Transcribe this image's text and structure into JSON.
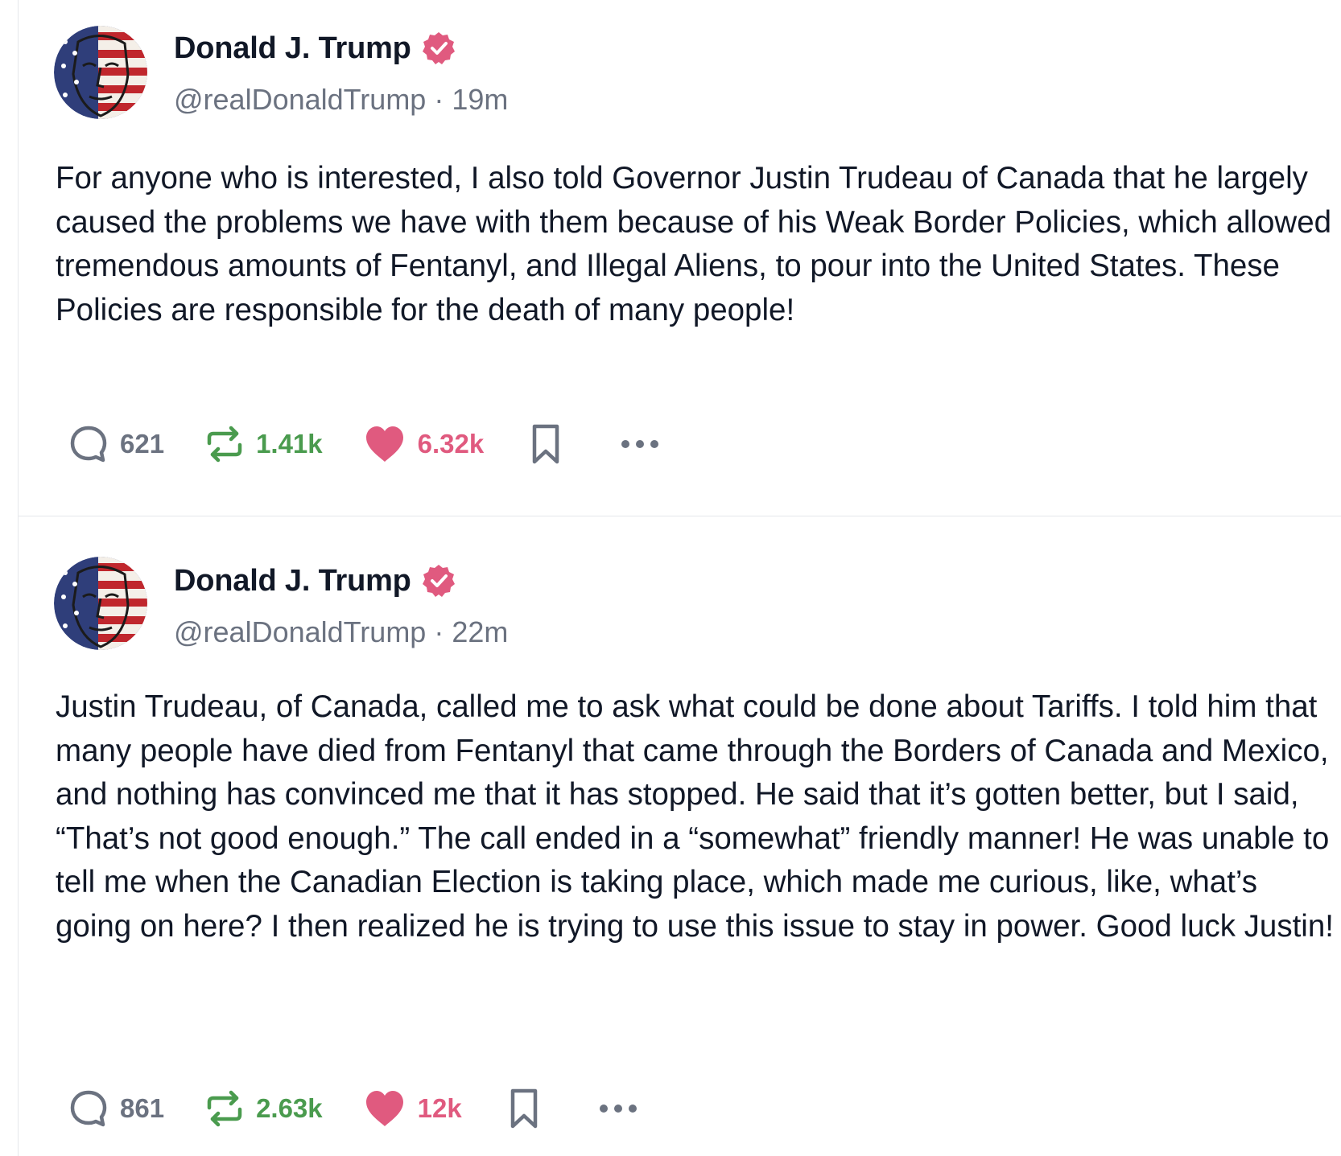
{
  "posts": [
    {
      "author": {
        "display_name": "Donald J. Trump",
        "handle": "@realDonaldTrump",
        "verified": true,
        "avatar_icon": "flag-face-avatar"
      },
      "time": "19m",
      "separator": "·",
      "text": "For anyone who is interested, I also told Governor Justin Trudeau of Canada that he largely caused the problems we have with them because of his Weak Border Policies, which allowed tremendous amounts of Fentanyl, and Illegal Aliens, to pour into the United States. These Policies are responsible for the death of many people!",
      "stats": {
        "replies": "621",
        "reposts": "1.41k",
        "likes": "6.32k"
      }
    },
    {
      "author": {
        "display_name": "Donald J. Trump",
        "handle": "@realDonaldTrump",
        "verified": true,
        "avatar_icon": "flag-face-avatar"
      },
      "time": "22m",
      "separator": "·",
      "text": "Justin Trudeau, of Canada, called me to ask what could be done about Tariffs. I told him that many people have died from Fentanyl that came through the Borders of Canada and Mexico, and nothing has convinced me that it has stopped. He said that it’s gotten better, but I said, “That’s not good enough.” The call ended in a “somewhat” friendly manner! He was unable to tell me when the Canadian Election is taking place, which made me curious, like, what’s going on here? I then realized he is trying to use this issue to stay in power. Good luck Justin!",
      "stats": {
        "replies": "861",
        "reposts": "2.63k",
        "likes": "12k"
      }
    }
  ],
  "icons": {
    "reply": "reply-bubble-icon",
    "repost": "repost-arrows-icon",
    "like": "heart-icon",
    "bookmark": "bookmark-icon",
    "more": "more-dots-icon",
    "verified": "verified-badge-icon"
  },
  "colors": {
    "text": "#111827",
    "muted": "#6b7280",
    "repost": "#4a9b4e",
    "like": "#e05a7f",
    "verified": "#e05a7f",
    "divider": "#e5e7eb"
  }
}
